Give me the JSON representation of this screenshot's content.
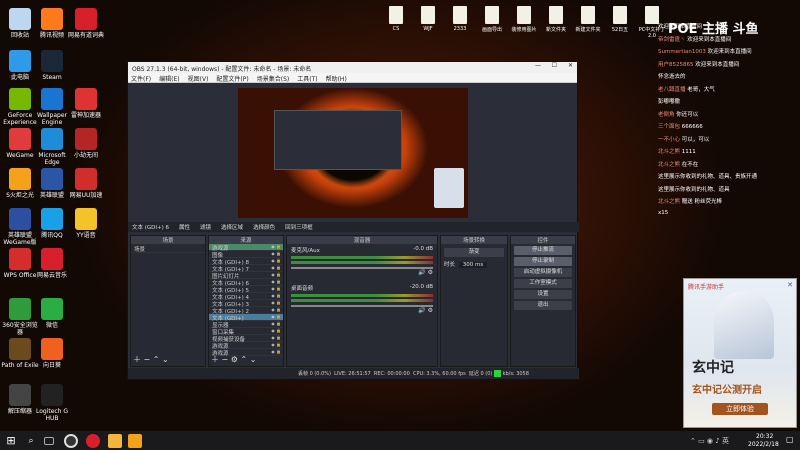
{
  "desktop_icons": [
    {
      "label": "回收站",
      "color": "#bcd7ef"
    },
    {
      "label": "腾讯视频",
      "color": "#ff7a1a"
    },
    {
      "label": "网易有道词典",
      "color": "#d8202c"
    },
    {
      "label": "此电脑",
      "color": "#2f9be8"
    },
    {
      "label": "Steam",
      "color": "#1b2838"
    },
    {
      "label": "GeForce Experience",
      "color": "#76b900"
    },
    {
      "label": "Wallpaper Engine",
      "color": "#1a74d2"
    },
    {
      "label": "雷神加速器",
      "color": "#d33"
    },
    {
      "label": "WeGame",
      "color": "#e23b3b"
    },
    {
      "label": "Microsoft Edge",
      "color": "#1e8cd6"
    },
    {
      "label": "小劫无间",
      "color": "#b52525"
    },
    {
      "label": "S火炬之光",
      "color": "#f3a21a"
    },
    {
      "label": "英雄联盟",
      "color": "#2a56a5"
    },
    {
      "label": "网易UU加速",
      "color": "#d22d2d"
    },
    {
      "label": "英雄联盟WeGame版",
      "color": "#2c4fa0"
    },
    {
      "label": "腾讯QQ",
      "color": "#1aa0e6"
    },
    {
      "label": "YY语音",
      "color": "#f5c22a"
    },
    {
      "label": "WPS Office",
      "color": "#d52c2c"
    },
    {
      "label": "网易云音乐",
      "color": "#d8202c"
    },
    {
      "label": "360安全浏览器",
      "color": "#2e9c3a"
    },
    {
      "label": "微信",
      "color": "#2aae44"
    },
    {
      "label": "Path of Exile",
      "color": "#6b4a1e"
    },
    {
      "label": "向日葵",
      "color": "#f06020"
    },
    {
      "label": "解压缩器",
      "color": "#444"
    },
    {
      "label": "Logitech G HUB",
      "color": "#222"
    }
  ],
  "folder_icons": [
    "CS",
    "WJF",
    "2333",
    "画面导出",
    "装修用图片",
    "新文件夹",
    "新建文件夹",
    "52日五",
    "PC中文补丁2.0"
  ],
  "watermark": "POE 主播 斗鱼",
  "obs": {
    "title": "OBS 27.1.3 (64-bit, windows) - 配置文件: 未命名 - 场景: 未命名",
    "menu": [
      "文件(F)",
      "编辑(E)",
      "视图(V)",
      "配置文件(P)",
      "场景集合(S)",
      "工具(T)",
      "帮助(H)"
    ],
    "ctrlbar": [
      "文本 (GDI+) 6",
      "属性",
      "滤镜",
      "选择区域",
      "选择颜色",
      "回到三项框"
    ],
    "docks": {
      "scenes": "场景",
      "sources": "来源",
      "mixer": "混音器",
      "transitions": "场景转换",
      "controls": "控件"
    },
    "scene_list": [
      "场景"
    ],
    "sources": [
      "游戏源",
      "图像",
      "文本 (GDI+) 8",
      "文本 (GDI+) 7",
      "图片幻灯片",
      "文本 (GDI+) 6",
      "文本 (GDI+) 5",
      "文本 (GDI+) 4",
      "文本 (GDI+) 3",
      "文本 (GDI+) 2",
      "文本 (GDI+)",
      "显示器",
      "窗口采集",
      "视频捕获设备",
      "游戏源",
      "游戏源"
    ],
    "mixer": [
      {
        "name": "麦克风/Aux",
        "db": "-0.0 dB"
      },
      {
        "name": "桌面音频",
        "db": "-20.0 dB"
      }
    ],
    "transition": {
      "type": "渐变",
      "duration_label": "时长",
      "duration": "300 ms"
    },
    "controls": [
      "停止推流",
      "停止录制",
      "启动虚拟摄像机",
      "工作室模式",
      "设置",
      "退出"
    ],
    "status": {
      "drop": "丢帧 0 (0.0%)",
      "live": "LIVE: 26:51:57",
      "rec": "REC: 00:00:00",
      "cpu": "CPU: 3.3%, 60.00 fps",
      "delay": "延迟 0 (0)",
      "kbps": "kb/s: 3058"
    }
  },
  "chat": [
    {
      "badge": "",
      "name": "",
      "text": "欢迎来到本直播间"
    },
    {
      "badge": "",
      "name": "帝剑雷霆丶",
      "text": "欢迎来到本直播间"
    },
    {
      "badge": "",
      "name": "Summertian1003",
      "text": "欢迎来到本直播间"
    },
    {
      "badge": "",
      "name": "用户8525865",
      "text": "欢迎来到本直播间"
    },
    {
      "badge": "",
      "name": "",
      "text": "怀念逝去的"
    },
    {
      "badge": "",
      "name": "老八蹲直播",
      "text": "老哥，大气"
    },
    {
      "badge": "",
      "name": "",
      "text": "彭嘟嘟撒"
    },
    {
      "badge": "",
      "name": "老倒角",
      "text": "你还可以"
    },
    {
      "badge": "",
      "name": "三个面包",
      "text": "666666"
    },
    {
      "badge": "",
      "name": "一不小心",
      "text": "可以，可以"
    },
    {
      "badge": "",
      "name": "北斗之熊",
      "text": "1111"
    },
    {
      "badge": "",
      "name": "北斗之熊",
      "text": "在不在"
    },
    {
      "badge": "",
      "name": "",
      "text": "这里展示你收到的礼物、道具、贵族开通"
    },
    {
      "badge": "",
      "name": "",
      "text": "这里展示你收到的礼物、道具"
    },
    {
      "badge": "",
      "name": "北斗之熊",
      "text": "赠送 粉丝荧光棒"
    },
    {
      "badge": "",
      "name": "",
      "text": "x15"
    }
  ],
  "ad": {
    "brand": "腾讯手游助手",
    "game": "玄中记",
    "headline": "玄中记公测开启",
    "cta": "立即体验"
  },
  "clock": {
    "time": "20:32",
    "date": "2022/2/18"
  }
}
